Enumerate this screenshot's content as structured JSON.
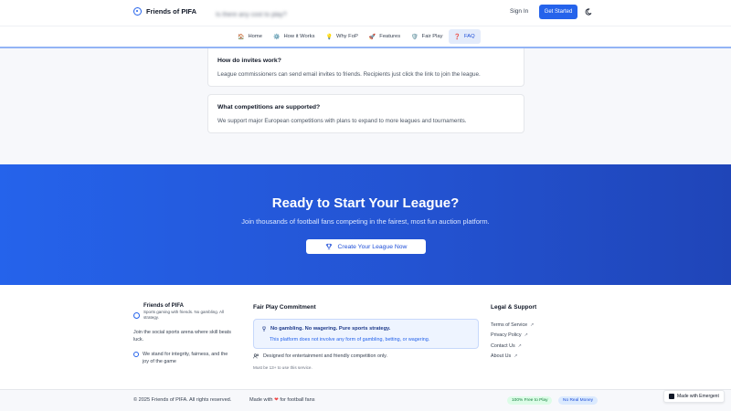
{
  "header": {
    "brand": "Friends of PIFA",
    "search_text": "Is there any cost to play?",
    "signin": "Sign In",
    "get_started": "Get Started",
    "theme_icon": "moon-icon"
  },
  "nav": {
    "items": [
      {
        "label": "Home",
        "icon": "home-icon",
        "glyph": "🏠"
      },
      {
        "label": "How it Works",
        "icon": "gear-icon",
        "glyph": "⚙️"
      },
      {
        "label": "Why FoP",
        "icon": "bulb-icon",
        "glyph": "💡"
      },
      {
        "label": "Features",
        "icon": "rocket-icon",
        "glyph": "🚀"
      },
      {
        "label": "Fair Play",
        "icon": "shield-icon",
        "glyph": "🛡️"
      },
      {
        "label": "FAQ",
        "icon": "question-icon",
        "glyph": "❓",
        "active": true
      }
    ]
  },
  "faq": [
    {
      "q": "How do invites work?",
      "a": "League commissioners can send email invites to friends. Recipients just click the link to join the league."
    },
    {
      "q": "What competitions are supported?",
      "a": "We support major European competitions with plans to expand to more leagues and tournaments."
    }
  ],
  "cta": {
    "title": "Ready to Start Your League?",
    "subtitle": "Join thousands of football fans competing in the fairest, most fun auction platform.",
    "button": "Create Your League Now",
    "button_icon": "trophy-icon"
  },
  "footer": {
    "brand": "Friends of PIFA",
    "tagline": "Sports gaming with friends. No gambling. All strategy.",
    "description": "Join the social sports arena where skill beats luck.",
    "value": "We stand for integrity, fairness, and the joy of the game",
    "fair_title": "Fair Play Commitment",
    "fair_box_title": "No gambling. No wagering. Pure sports strategy.",
    "fair_box_text": "This platform does not involve any form of gambling, betting, or wagering.",
    "entertainment": "Designed for entertainment and friendly competition only.",
    "age": "Must be 13+ to use this service.",
    "legal_title": "Legal & Support",
    "legal_links": [
      "Terms of Service",
      "Privacy Policy",
      "Contact Us",
      "About Us"
    ]
  },
  "bottom": {
    "copyright": "© 2025 Friends of PIFA. All rights reserved.",
    "made_prefix": "Made with",
    "made_suffix": "for football fans",
    "badge_free": "100% Free to Play",
    "badge_money": "No Real Money",
    "emergent": "Made with Emergent"
  },
  "colors": {
    "accent": "#2563eb",
    "cta_bg": "#2356d6"
  }
}
